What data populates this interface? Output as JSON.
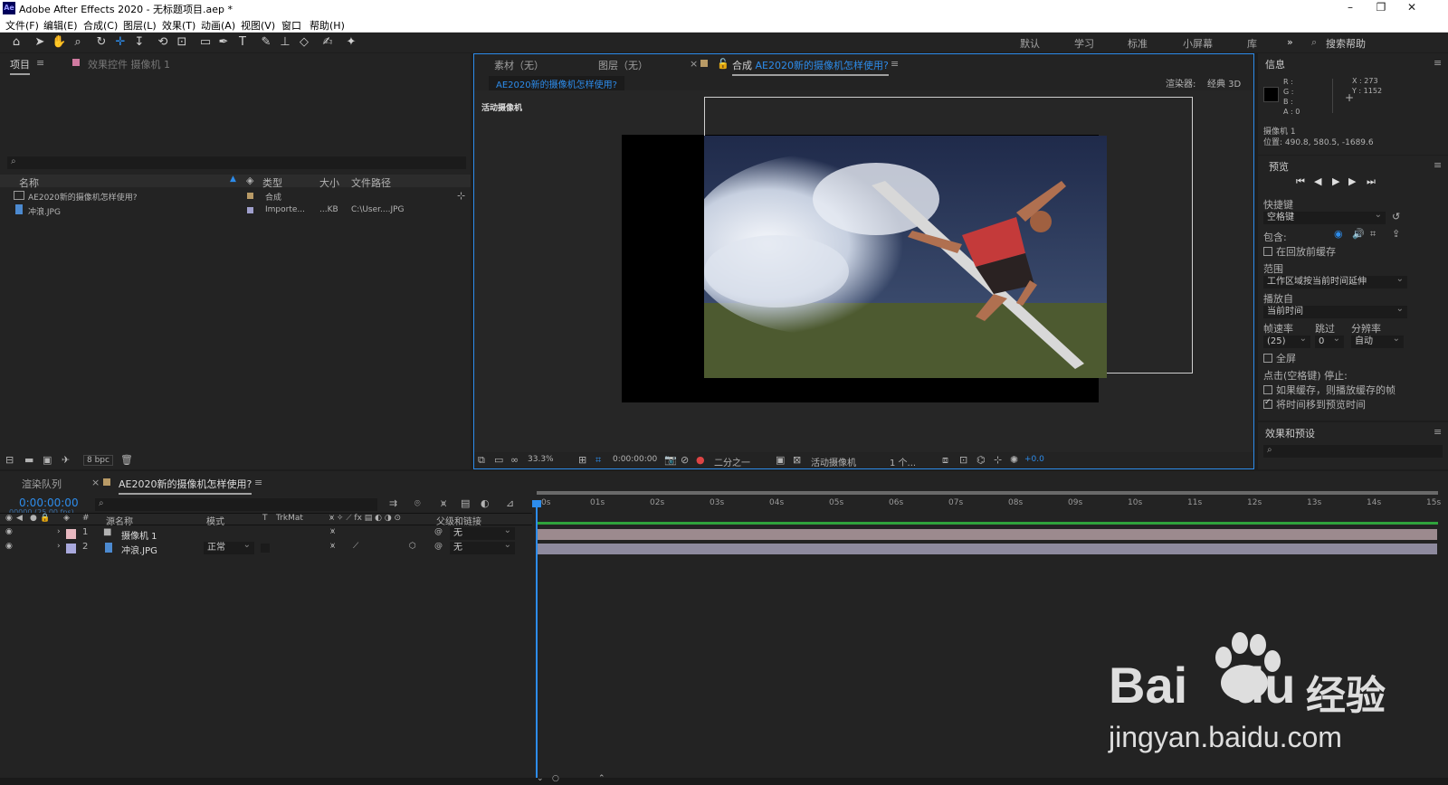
{
  "app": {
    "title": "Adobe After Effects 2020 - 无标题项目.aep *",
    "icon_label": "Ae"
  },
  "window_controls": {
    "minimize": "–",
    "restore": "❐",
    "close": "✕"
  },
  "menu": [
    "文件(F)",
    "编辑(E)",
    "合成(C)",
    "图层(L)",
    "效果(T)",
    "动画(A)",
    "视图(V)",
    "窗口",
    "帮助(H)"
  ],
  "workspaces": [
    "默认",
    "学习",
    "标准",
    "小屏幕",
    "库"
  ],
  "search_help_placeholder": "搜索帮助",
  "project_panel": {
    "tab_project": "项目",
    "tab_effects": "效果控件 摄像机 1",
    "columns": [
      "名称",
      "类型",
      "大小",
      "文件路径"
    ],
    "items": [
      {
        "name": "AE2020新的摄像机怎样使用?",
        "type": "合成",
        "size": "",
        "path": "",
        "label_color": "#b89a66"
      },
      {
        "name": "冲浪.JPG",
        "type": "Importe...",
        "size": "...KB",
        "path": "C:\\User....JPG",
        "label_color": "#9f9fcc"
      }
    ],
    "bpc": "8 bpc"
  },
  "viewer": {
    "tab_footage": "素材（无）",
    "tab_layer": "图层（无）",
    "tab_comp_prefix": "合成",
    "tab_comp_name": "AE2020新的摄像机怎样使用?",
    "breadcrumb": "AE2020新的摄像机怎样使用?",
    "renderer_label": "渲染器:",
    "renderer_value": "经典 3D",
    "active_camera_label": "活动摄像机",
    "zoom": "33.3%",
    "timecode": "0:00:00:00",
    "resolution": "二分之一",
    "camera_view": "活动摄像机",
    "views": "1 个...",
    "exposure": "+0.0"
  },
  "info_panel": {
    "title": "信息",
    "r": "R :",
    "g": "G :",
    "b": "B :",
    "a": "A :  0",
    "x": "X : 273",
    "y": "Y : 1152",
    "layer_name": "摄像机 1",
    "position": "位置: 490.8, 580.5, -1689.6"
  },
  "preview_panel": {
    "title": "预览",
    "shortcut_label": "快捷键",
    "shortcut_value": "空格键",
    "include_label": "包含:",
    "cache_before_playback": "在回放前缓存",
    "range_label": "范围",
    "range_value": "工作区域按当前时间延伸",
    "play_from_label": "播放自",
    "play_from_value": "当前时间",
    "fps_label": "帧速率",
    "skip_label": "跳过",
    "res_label": "分辨率",
    "fps_value": "(25)",
    "skip_value": "0",
    "res_value": "自动",
    "fullscreen": "全屏",
    "stop_label": "点击(空格键) 停止:",
    "opt_cache": "如果缓存，则播放缓存的帧",
    "opt_move_time": "将时间移到预览时间"
  },
  "effects_panel": {
    "title": "效果和预设"
  },
  "timeline": {
    "tab_render": "渲染队列",
    "tab_comp": "AE2020新的摄像机怎样使用?",
    "timecode": "0:00:00:00",
    "fps_info": "00000 (25.00 fps)",
    "columns": {
      "num": "#",
      "source": "源名称",
      "mode": "模式",
      "t": "T",
      "trkmat": "TrkMat",
      "parent": "父级和链接"
    },
    "layers": [
      {
        "num": "1",
        "name": "摄像机 1",
        "mode": "",
        "parent": "无",
        "label_color": "#e8b8c0",
        "bar_color": "#9c8a8e"
      },
      {
        "num": "2",
        "name": "冲浪.JPG",
        "mode": "正常",
        "parent": "无",
        "label_color": "#a9a9dd",
        "bar_color": "#8e8a9e"
      }
    ],
    "ticks": [
      "0s",
      "01s",
      "02s",
      "03s",
      "04s",
      "05s",
      "06s",
      "07s",
      "08s",
      "09s",
      "10s",
      "11s",
      "12s",
      "13s",
      "14s",
      "15s"
    ]
  },
  "watermark": {
    "brand": "Bai",
    "brand2": "du",
    "cn": "经验",
    "url": "jingyan.baidu.com"
  },
  "colors": {
    "accent": "#2d8ceb",
    "panel": "#232323",
    "bg": "#1d1d1d"
  }
}
